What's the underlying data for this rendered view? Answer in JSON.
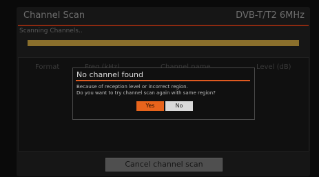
{
  "header": {
    "title": "Channel Scan",
    "mode": "DVB-T/T2 6MHz"
  },
  "scan": {
    "status": "Scanning Channels..",
    "progress": 1.0
  },
  "table": {
    "columns": [
      "Format",
      "Freq (kHz)",
      "Channel name",
      "Level (dB)"
    ]
  },
  "dialog": {
    "title": "No channel found",
    "line1": "Because of reception level or incorrect region.",
    "line2": "Do you want to try channel scan again with same region?",
    "yes": "Yes",
    "no": "No"
  },
  "actions": {
    "cancel": "Cancel channel scan"
  },
  "colors": {
    "accent": "#e05a20",
    "header_line": "#8c2a10",
    "progress": "#8a6f2c"
  }
}
